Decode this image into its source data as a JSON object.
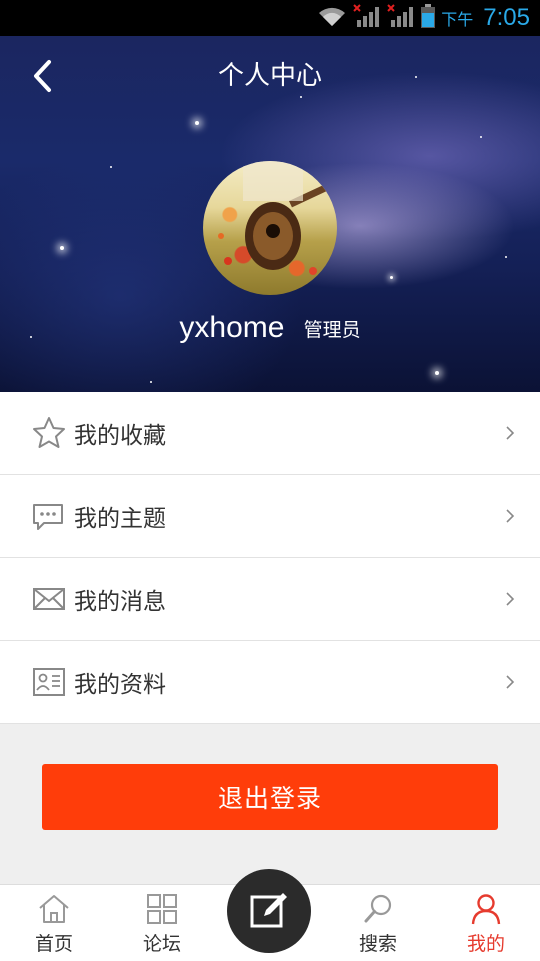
{
  "status_bar": {
    "ampm": "下午",
    "time": "7:05",
    "icons": [
      "wifi-icon",
      "signal-icon",
      "signal-icon",
      "battery-icon"
    ],
    "accent_color": "#2aa9e8"
  },
  "header": {
    "title": "个人中心",
    "back_icon": "back-arrow-icon"
  },
  "profile": {
    "username": "yxhome",
    "role": "管理员"
  },
  "menu": {
    "items": [
      {
        "label": "我的收藏",
        "icon": "star-icon"
      },
      {
        "label": "我的主题",
        "icon": "chat-bubble-icon"
      },
      {
        "label": "我的消息",
        "icon": "envelope-icon"
      },
      {
        "label": "我的资料",
        "icon": "profile-card-icon"
      }
    ]
  },
  "logout": {
    "label": "退出登录",
    "color": "#ff3d0a"
  },
  "bottom_nav": {
    "items": [
      {
        "label": "首页",
        "icon": "home-icon"
      },
      {
        "label": "论坛",
        "icon": "grid-icon"
      },
      {
        "label": "搜索",
        "icon": "search-icon"
      },
      {
        "label": "我的",
        "icon": "person-icon",
        "active": true
      }
    ],
    "post_icon": "edit-icon",
    "active_color": "#e63b2e"
  }
}
